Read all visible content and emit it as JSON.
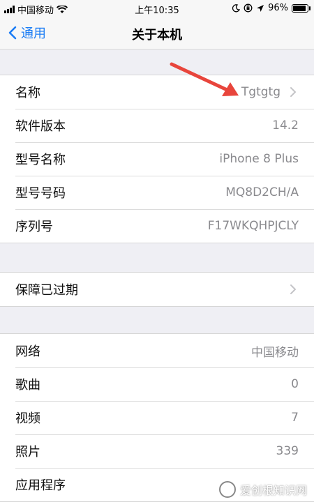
{
  "status_bar": {
    "carrier": "中国移动",
    "time": "上午10:35",
    "battery_percent": "96%",
    "battery_level": 0.96,
    "icons": [
      "signal-icon",
      "wifi-icon",
      "moon-icon",
      "lock-rotation-icon",
      "location-icon",
      "battery-icon"
    ]
  },
  "nav": {
    "back_label": "通用",
    "title": "关于本机"
  },
  "groups": [
    {
      "rows": [
        {
          "label": "名称",
          "value": "Tgtgtg",
          "chevron": true
        },
        {
          "label": "软件版本",
          "value": "14.2",
          "chevron": false
        },
        {
          "label": "型号名称",
          "value": "iPhone 8 Plus",
          "chevron": false
        },
        {
          "label": "型号号码",
          "value": "MQ8D2CH/A",
          "chevron": false
        },
        {
          "label": "序列号",
          "value": "F17WKQHPJCLY",
          "chevron": false
        }
      ]
    },
    {
      "rows": [
        {
          "label": "保障已过期",
          "value": "",
          "chevron": true
        }
      ]
    },
    {
      "rows": [
        {
          "label": "网络",
          "value": "中国移动",
          "chevron": false
        },
        {
          "label": "歌曲",
          "value": "0",
          "chevron": false
        },
        {
          "label": "视频",
          "value": "7",
          "chevron": false
        },
        {
          "label": "照片",
          "value": "339",
          "chevron": false
        },
        {
          "label": "应用程序",
          "value": "",
          "chevron": false
        }
      ]
    }
  ],
  "watermark": {
    "text": "爱创根知识网"
  },
  "colors": {
    "accent": "#1a7cf5",
    "annotation_arrow": "#e8453c",
    "background": "#efeff4",
    "secondary_text": "#8a8a8e"
  }
}
